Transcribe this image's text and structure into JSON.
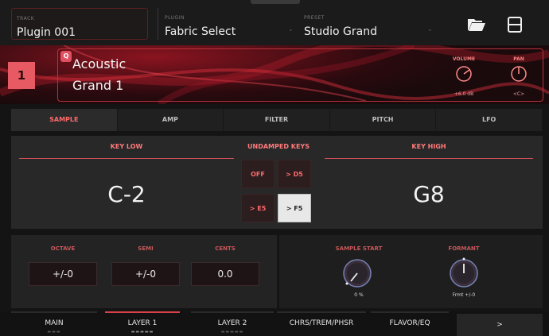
{
  "header": {
    "track": {
      "label": "TRACK",
      "value": "Plugin 001"
    },
    "plugin": {
      "label": "PLUGIN",
      "value": "Fabric Select"
    },
    "preset": {
      "label": "PRESET",
      "value": "Studio Grand"
    },
    "icons": {
      "open": "folder-open-icon",
      "save": "save-icon"
    }
  },
  "track": {
    "number": "1",
    "badge": "Q",
    "name_line1": "Acoustic",
    "name_line2": "Grand 1",
    "volume": {
      "label": "VOLUME",
      "value": "+6.0 dB"
    },
    "pan": {
      "label": "PAN",
      "value": "<C>"
    }
  },
  "tabs": [
    {
      "label": "SAMPLE",
      "active": true
    },
    {
      "label": "AMP",
      "active": false
    },
    {
      "label": "FILTER",
      "active": false
    },
    {
      "label": "PITCH",
      "active": false
    },
    {
      "label": "LFO",
      "active": false
    }
  ],
  "keys": {
    "key_low": {
      "label": "KEY LOW",
      "value": "C-2"
    },
    "undamped": {
      "label": "UNDAMPED KEYS",
      "options": [
        "OFF",
        "> D5",
        "> E5",
        "> F5"
      ],
      "selected": "> F5"
    },
    "key_high": {
      "label": "KEY HIGH",
      "value": "G8"
    }
  },
  "tuning": {
    "octave": {
      "label": "OCTAVE",
      "value": "+/-0"
    },
    "semi": {
      "label": "SEMI",
      "value": "+/-0"
    },
    "cents": {
      "label": "CENTS",
      "value": "0.0"
    }
  },
  "sample_start": {
    "label": "SAMPLE START",
    "value": "0 %"
  },
  "formant": {
    "label": "FORMANT",
    "value": "Frmt +/-0"
  },
  "nav": [
    {
      "label": "MAIN",
      "active": false
    },
    {
      "label": "LAYER 1",
      "active": true
    },
    {
      "label": "LAYER 2",
      "active": false
    },
    {
      "label": "CHRS/TREM/PHSR",
      "active": false
    },
    {
      "label": "FLAVOR/EQ",
      "active": false
    }
  ],
  "nav_more": ">",
  "colors": {
    "accent": "#e0404c",
    "accent_text": "#ff6b6b",
    "background": "#141414"
  }
}
